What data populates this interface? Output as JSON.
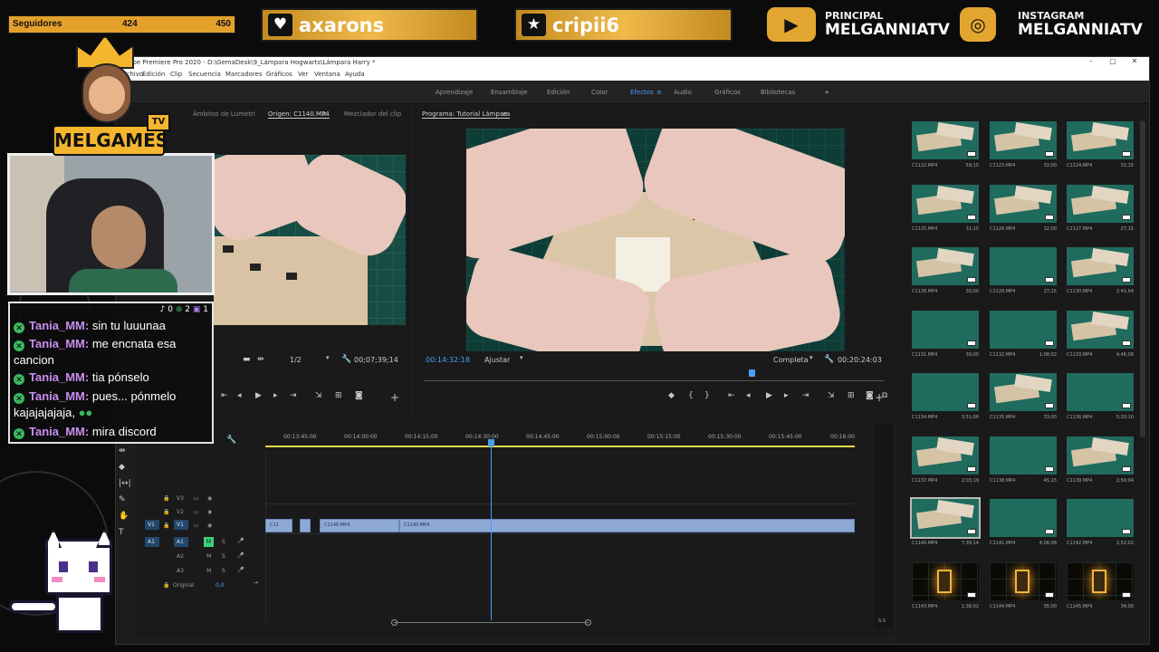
{
  "overlay": {
    "goal": {
      "label": "Seguidores",
      "current": "424",
      "max": "450"
    },
    "alerts": [
      {
        "icon": "heart-icon",
        "name": "axarons"
      },
      {
        "icon": "star-icon",
        "name": "cripii6"
      }
    ],
    "socials": [
      {
        "icon": "youtube-icon",
        "label": "PRINCIPAL",
        "value": "MELGANNIATV"
      },
      {
        "icon": "instagram-icon",
        "label": "INSTAGRAM",
        "value": "MELGANNIATV"
      }
    ],
    "brand": "MELGAMES",
    "brand_sub": "TV",
    "chat": {
      "counts": {
        "tiktok": "0",
        "xbox": "2",
        "twitch": "1"
      },
      "messages": [
        {
          "user": "Tania_MM:",
          "text": "sin tu luuunaa"
        },
        {
          "user": "Tania_MM:",
          "text": "me encnata esa cancion"
        },
        {
          "user": "Tania_MM:",
          "text": "tia pónselo"
        },
        {
          "user": "Tania_MM:",
          "text": "pues... pónmelo kajajajajaja,"
        },
        {
          "user": "Tania_MM:",
          "text": "mira discord"
        }
      ]
    }
  },
  "premiere": {
    "title": "Adobe Premiere Pro 2020 - D:\\GemaDesk\\9_Lámpara Hogwarts\\Lámpara Harry *",
    "menu": [
      "Archivo",
      "Edición",
      "Clip",
      "Secuencia",
      "Marcadores",
      "Gráficos",
      "Ver",
      "Ventana",
      "Ayuda"
    ],
    "workspaces": [
      "Aprendizaje",
      "Ensamblaje",
      "Edición",
      "Color",
      "Efectos",
      "Audio",
      "Gráficos",
      "Bibliotecas"
    ],
    "active_workspace": "Efectos",
    "source": {
      "tabs": [
        "Ámbitos de Lumetri",
        "Origen: C1140.MP4",
        "Mezclador del clip"
      ],
      "active_tab": "Origen: C1140.MP4",
      "zoom": "1/2",
      "duration": "00;07;39;14"
    },
    "program": {
      "tab": "Programa: Tutorial Lámpara",
      "timecode": "00:14:32:18",
      "fit": "Ajustar",
      "quality": "Completa",
      "duration": "00:20:24:03",
      "playhead_fraction": 0.712
    },
    "timeline": {
      "ruler": [
        "00:13:45:00",
        "00:14:00:00",
        "00:14:15:00",
        "00:14:30:00",
        "00:14:45:00",
        "00:15:00:00",
        "00:15:15:00",
        "00:15:30:00",
        "00:15:45:00",
        "00:16:00"
      ],
      "video_tracks": [
        "V3",
        "V2",
        "V1"
      ],
      "audio_tracks": [
        "A1",
        "A2",
        "A3"
      ],
      "master_label": "Original",
      "master_value": "0,0",
      "clips": [
        "C11",
        "",
        "C1140.MP4",
        "C1140.MP4"
      ],
      "meter_label": "S S"
    },
    "bin": [
      {
        "name": "C1122.MP4",
        "dur": "59;15",
        "type": "wood"
      },
      {
        "name": "C1123.MP4",
        "dur": "32;00",
        "type": "wood"
      },
      {
        "name": "C1124.MP4",
        "dur": "31;15",
        "type": "wood"
      },
      {
        "name": "C1125.MP4",
        "dur": "31;15",
        "type": "wood"
      },
      {
        "name": "C1126.MP4",
        "dur": "32;00",
        "type": "wood"
      },
      {
        "name": "C1127.MP4",
        "dur": "27;15",
        "type": "wood"
      },
      {
        "name": "C1128.MP4",
        "dur": "30;00",
        "type": "wood"
      },
      {
        "name": "C1129.MP4",
        "dur": "27;15",
        "type": "plain"
      },
      {
        "name": "C1130.MP4",
        "dur": "2;41;04",
        "type": "wood"
      },
      {
        "name": "C1131.MP4",
        "dur": "39;00",
        "type": "plain"
      },
      {
        "name": "C1132.MP4",
        "dur": "1;08;02",
        "type": "plain"
      },
      {
        "name": "C1133.MP4",
        "dur": "4;46;08",
        "type": "wood"
      },
      {
        "name": "C1134.MP4",
        "dur": "3;51;06",
        "type": "plain"
      },
      {
        "name": "C1135.MP4",
        "dur": "33;00",
        "type": "wood"
      },
      {
        "name": "C1136.MP4",
        "dur": "5;20;10",
        "type": "plain"
      },
      {
        "name": "C1137.MP4",
        "dur": "2;03;19",
        "type": "wood"
      },
      {
        "name": "C1138.MP4",
        "dur": "45;15",
        "type": "plain"
      },
      {
        "name": "C1139.MP4",
        "dur": "2;59;04",
        "type": "wood"
      },
      {
        "name": "C1140.MP4",
        "dur": "7;39;14",
        "type": "wood"
      },
      {
        "name": "C1141.MP4",
        "dur": "4;06;08",
        "type": "plain"
      },
      {
        "name": "C1142.MP4",
        "dur": "1;52;02",
        "type": "plain"
      },
      {
        "name": "C1143.MP4",
        "dur": "1;38;02",
        "type": "dark"
      },
      {
        "name": "C1144.MP4",
        "dur": "35;00",
        "type": "dark"
      },
      {
        "name": "C1145.MP4",
        "dur": "34;00",
        "type": "dark"
      }
    ]
  },
  "colors": {
    "accent": "#e3a12c",
    "premiere_blue": "#4f9df7",
    "clip": "#8fa9d6",
    "chat_user": "#c88ff2"
  }
}
